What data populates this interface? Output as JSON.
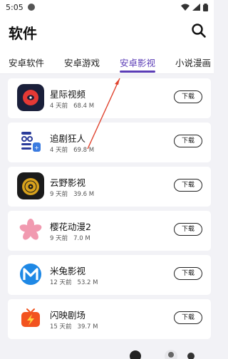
{
  "status_bar": {
    "time": "5:05"
  },
  "header": {
    "title": "软件"
  },
  "tabs": [
    {
      "label": "安卓软件"
    },
    {
      "label": "安卓游戏"
    },
    {
      "label": "安卓影视"
    },
    {
      "label": "小说漫画"
    }
  ],
  "active_tab_index": 2,
  "apps": [
    {
      "name": "星际视频",
      "time": "4 天前",
      "size": "68.4 M",
      "button": "下载",
      "icon": "red-record-icon"
    },
    {
      "name": "追剧狂人",
      "time": "4 天前",
      "size": "69.8 M",
      "button": "下载",
      "icon": "robot-face-icon"
    },
    {
      "name": "云野影视",
      "time": "9 天前",
      "size": "39.6 M",
      "button": "下载",
      "icon": "gold-vinyl-icon"
    },
    {
      "name": "樱花动漫2",
      "time": "9 天前",
      "size": "7.0 M",
      "button": "下载",
      "icon": "sakura-icon"
    },
    {
      "name": "米兔影视",
      "time": "12 天前",
      "size": "53.2 M",
      "button": "下载",
      "icon": "blue-m-icon"
    },
    {
      "name": "闪映剧场",
      "time": "15 天前",
      "size": "39.7 M",
      "button": "下载",
      "icon": "tv-lightning-icon"
    }
  ],
  "colors": {
    "accent": "#5b3db6",
    "annotation_arrow": "#e0442f",
    "page_bg": "#f2f2f6"
  }
}
